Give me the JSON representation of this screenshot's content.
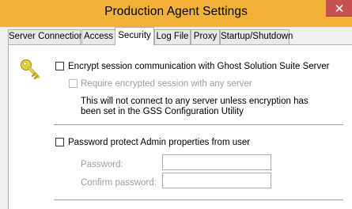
{
  "window": {
    "title": "Production Agent Settings"
  },
  "tabs": [
    {
      "label": "Server Connection"
    },
    {
      "label": "Access"
    },
    {
      "label": "Security"
    },
    {
      "label": "Log File"
    },
    {
      "label": "Proxy"
    },
    {
      "label": "Startup/Shutdown"
    }
  ],
  "active_tab": "Security",
  "security": {
    "encrypt": {
      "label": "Encrypt session communication with Ghost Solution Suite Server",
      "checked": false
    },
    "require_encrypted": {
      "label": "Require encrypted session with any server",
      "checked": false,
      "enabled": false
    },
    "note_line1": "This will not connect to any server unless encryption has",
    "note_line2": "been set in the GSS Configuration Utility",
    "password_protect": {
      "label": "Password protect Admin properties from user",
      "checked": false
    },
    "password": {
      "label": "Password:",
      "value": ""
    },
    "confirm_password": {
      "label": "Confirm password:",
      "value": ""
    }
  },
  "icons": {
    "close": "close-icon",
    "key": "key-icon"
  },
  "colors": {
    "titlebar": "#f2b23a",
    "close_button": "#c75050"
  }
}
